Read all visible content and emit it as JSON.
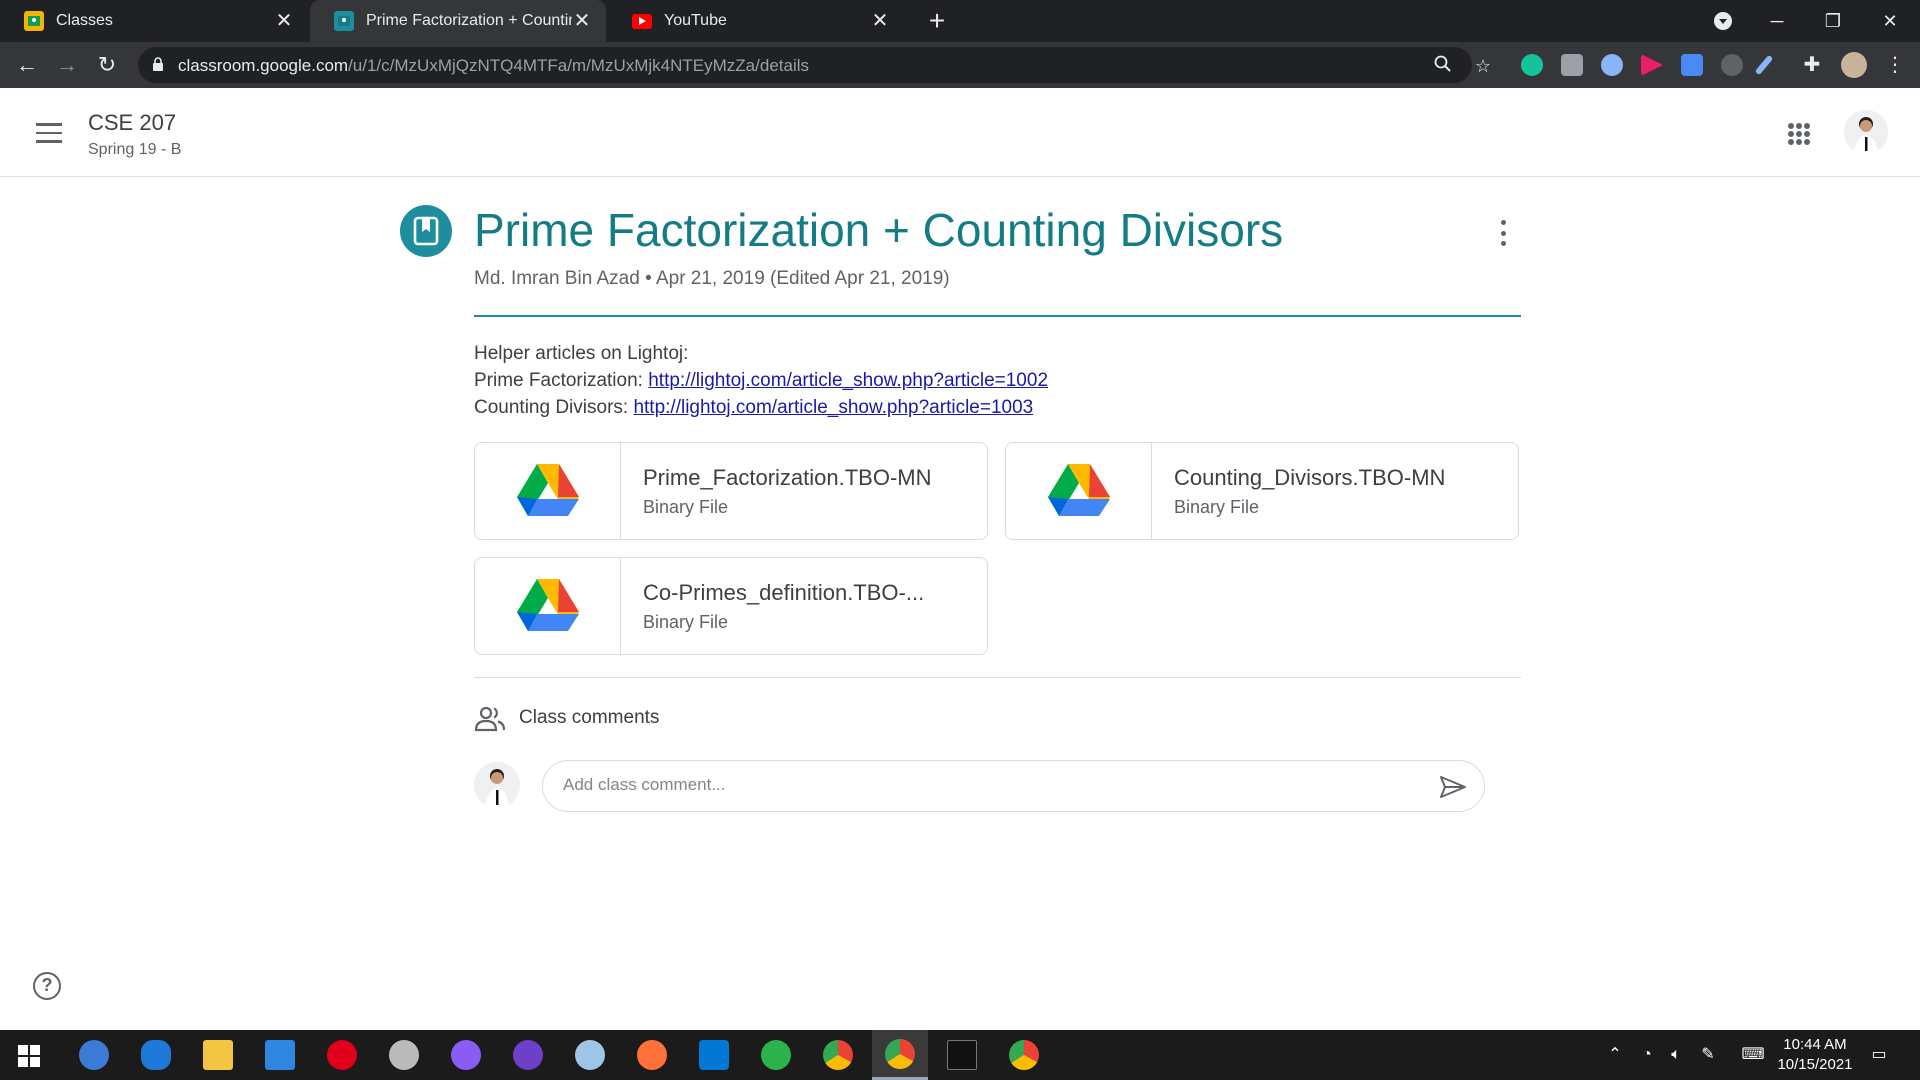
{
  "browser": {
    "tabs": [
      {
        "title": "Classes",
        "active": false
      },
      {
        "title": "Prime Factorization + Counting Divisors",
        "active": true
      },
      {
        "title": "YouTube",
        "active": false
      }
    ],
    "new_tab": "+",
    "url_host": "classroom.google.com",
    "url_path": "/u/1/c/MzUxMjQzNTQ4MTFa/m/MzUxMjk4NTEyMzZa/details"
  },
  "header": {
    "class_title": "CSE 207",
    "class_section": "Spring 19 - B"
  },
  "material": {
    "title": "Prime Factorization + Counting Divisors",
    "meta": "Md. Imran Bin Azad • Apr 21, 2019 (Edited Apr 21, 2019)",
    "description": {
      "line1": "Helper articles on Lightoj:",
      "line2_label": "Prime Factorization: ",
      "line2_link": "http://lightoj.com/article_show.php?article=1002",
      "line3_label": "Counting Divisors: ",
      "line3_link": "http://lightoj.com/article_show.php?article=1003"
    },
    "attachments": [
      {
        "name": "Prime_Factorization.TBO-MN",
        "type": "Binary File",
        "icon": "google-drive-icon"
      },
      {
        "name": "Counting_Divisors.TBO-MN",
        "type": "Binary File",
        "icon": "google-drive-icon"
      },
      {
        "name": "Co-Primes_definition.TBO-...",
        "type": "Binary File",
        "icon": "google-drive-icon"
      }
    ]
  },
  "comments": {
    "label": "Class comments",
    "placeholder": "Add class comment..."
  },
  "taskbar": {
    "time": "10:44 AM",
    "date": "10/15/2021"
  },
  "colors": {
    "accent": "#137c85",
    "link": "#1a1aa6",
    "chrome_dark": "#202124",
    "chrome_toolbar": "#35363a",
    "taskbar": "#1b1b1b"
  }
}
